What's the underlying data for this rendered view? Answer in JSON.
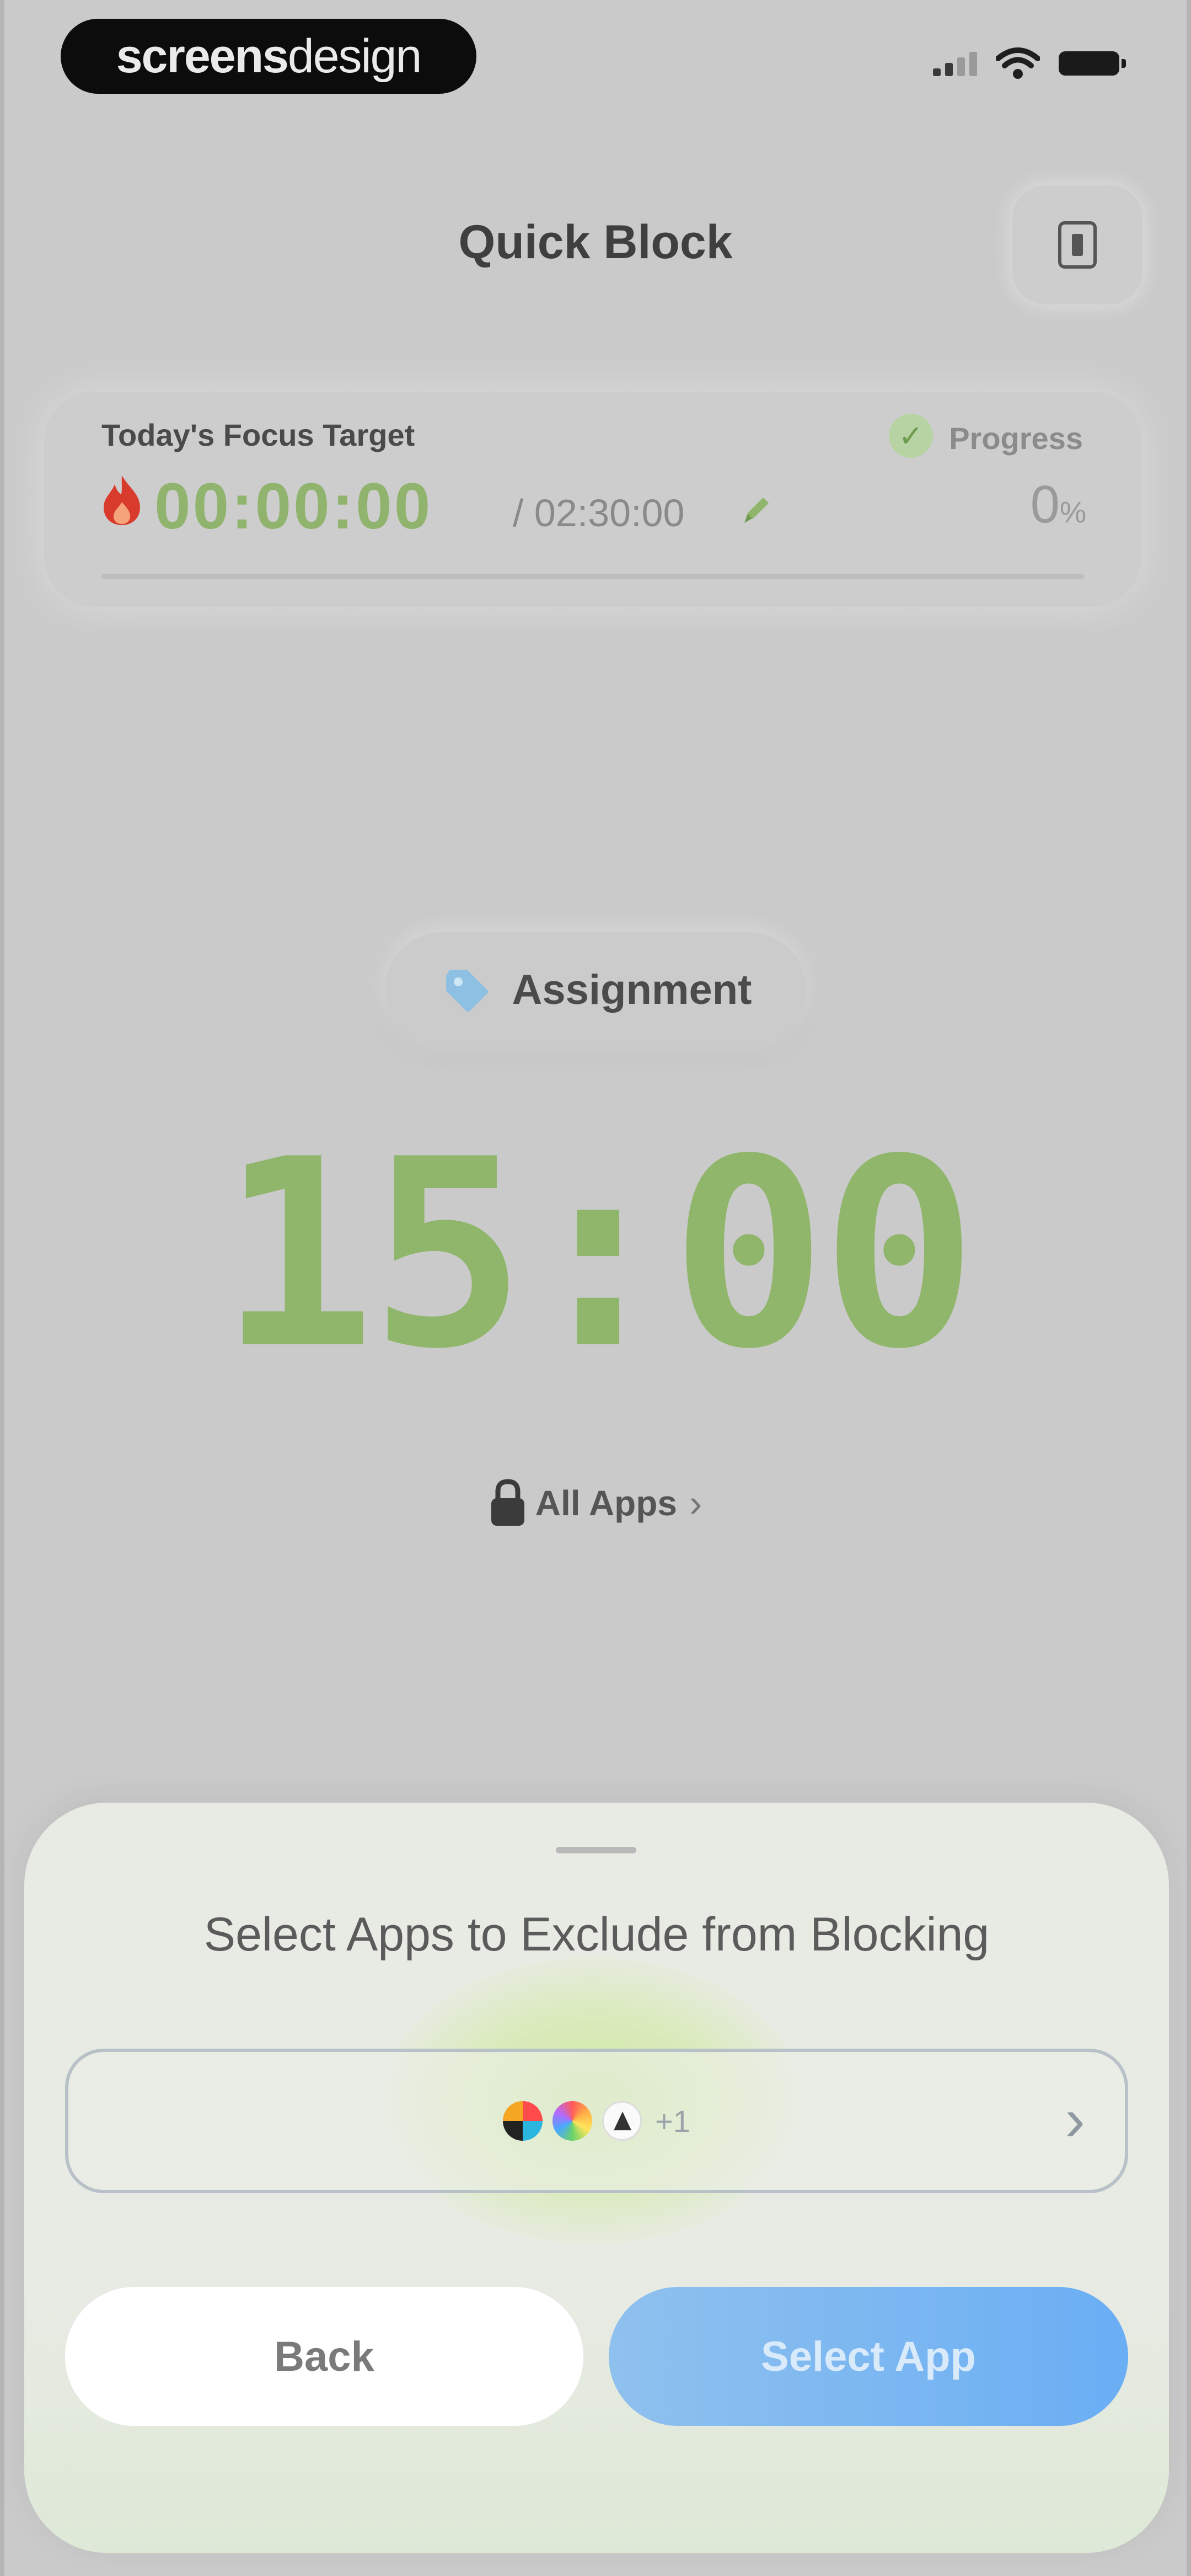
{
  "status_bar": {
    "brand_bold": "screens",
    "brand_light": "design"
  },
  "header": {
    "title": "Quick Block"
  },
  "focus_card": {
    "label": "Today's Focus Target",
    "progress_label": "Progress",
    "elapsed": "00:00:00",
    "target": "/ 02:30:00",
    "percent_value": "0",
    "percent_unit": "%",
    "progress_fraction": 0
  },
  "session": {
    "tag_label": "Assignment",
    "timer": "15:00",
    "timer_color": "#8fb66b"
  },
  "block_scope": {
    "label": "All Apps"
  },
  "sheet": {
    "title": "Select Apps to Exclude from Blocking",
    "extra_apps_count": "+1",
    "back_label": "Back",
    "select_label": "Select App",
    "accent_color": "#6aaef4"
  },
  "icons": [
    "signal-icon",
    "wifi-icon",
    "battery-icon",
    "info-icon",
    "check-icon",
    "flame-icon",
    "pencil-icon",
    "tag-icon",
    "lock-icon",
    "chevron-right-icon"
  ]
}
